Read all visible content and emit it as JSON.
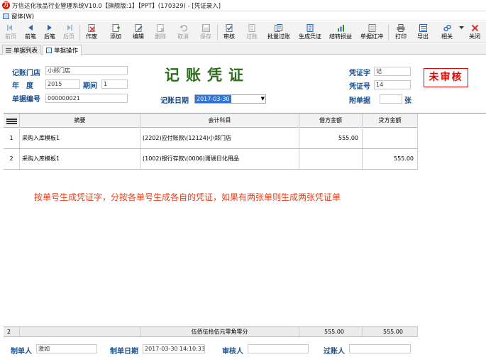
{
  "window": {
    "title": "万信达化妆品行业管理系统V10.0【旗舰版:1】【PPT】(170329) - [凭证录入]",
    "logo": "万"
  },
  "menubar": {
    "window_menu": "窗体(W)"
  },
  "toolbar": {
    "items": [
      {
        "label": "前页",
        "icon": "prev-page-icon",
        "enabled": false
      },
      {
        "label": "前笔",
        "icon": "prev-record-icon",
        "enabled": true
      },
      {
        "label": "后笔",
        "icon": "next-record-icon",
        "enabled": true
      },
      {
        "label": "后页",
        "icon": "next-page-icon",
        "enabled": false
      },
      {
        "label": "作废",
        "icon": "void-icon",
        "enabled": true
      },
      {
        "label": "添加",
        "icon": "add-icon",
        "enabled": true
      },
      {
        "label": "编辑",
        "icon": "edit-icon",
        "enabled": true
      },
      {
        "label": "删除",
        "icon": "delete-icon",
        "enabled": false
      },
      {
        "label": "取消",
        "icon": "undo-icon",
        "enabled": false
      },
      {
        "label": "保存",
        "icon": "save-icon",
        "enabled": false
      },
      {
        "label": "审核",
        "icon": "audit-icon",
        "enabled": true
      },
      {
        "label": "过账",
        "icon": "post-icon",
        "enabled": false
      },
      {
        "label": "批量过账",
        "icon": "batch-post-icon",
        "enabled": true
      },
      {
        "label": "生成凭证",
        "icon": "generate-voucher-icon",
        "enabled": true
      },
      {
        "label": "结转损益",
        "icon": "carry-forward-icon",
        "enabled": true
      },
      {
        "label": "单据红冲",
        "icon": "reverse-icon",
        "enabled": true
      },
      {
        "label": "打印",
        "icon": "print-icon",
        "enabled": true
      },
      {
        "label": "导出",
        "icon": "export-icon",
        "enabled": true
      },
      {
        "label": "相关",
        "icon": "related-icon",
        "enabled": true
      },
      {
        "label": "关闭",
        "icon": "close-icon",
        "enabled": true
      }
    ]
  },
  "tabs": [
    {
      "label": "单据列表"
    },
    {
      "label": "单据操作"
    }
  ],
  "form": {
    "title": "记账凭证",
    "status_stamp": "未审核",
    "store_label": "记账门店",
    "store_value": "小郑门店",
    "year_label": "年　度",
    "year_value": "2015",
    "period_label": "期间",
    "period_value": "1",
    "docno_label": "单据编号",
    "docno_value": "000000021",
    "date_label": "记账日期",
    "date_value": "2017-03-30",
    "voucher_word_label": "凭证字",
    "voucher_word_value": "记",
    "voucher_no_label": "凭证号",
    "voucher_no_value": "14",
    "attach_label": "附单据",
    "attach_value": "",
    "attach_unit": "张"
  },
  "grid": {
    "columns": {
      "summary": "摘要",
      "account": "会计科目",
      "debit": "借方金额",
      "credit": "贷方金额"
    },
    "rows": [
      {
        "no": "1",
        "summary": "采购入库模板1",
        "account": "(2202)应付账款\\(12124)小郑门店",
        "debit": "555.00",
        "credit": ""
      },
      {
        "no": "2",
        "summary": "采购入库模板1",
        "account": "(1002)银行存款\\(0006)珊瑚日化用品",
        "debit": "",
        "credit": "555.00"
      }
    ],
    "note": "按单号生成凭证字，分按各单号生成各自的凭证，如果有两张单则生成两张凭证单",
    "footer": {
      "count": "2",
      "amount_words": "伍佰伍拾伍元零角零分",
      "debit_total": "555.00",
      "credit_total": "555.00"
    }
  },
  "bottom": {
    "maker_label": "制单人",
    "maker_value": "激如",
    "make_date_label": "制单日期",
    "make_date_value": "2017-03-30 14:10:33",
    "auditor_label": "审核人",
    "auditor_value": "",
    "poster_label": "过账人",
    "poster_value": ""
  }
}
